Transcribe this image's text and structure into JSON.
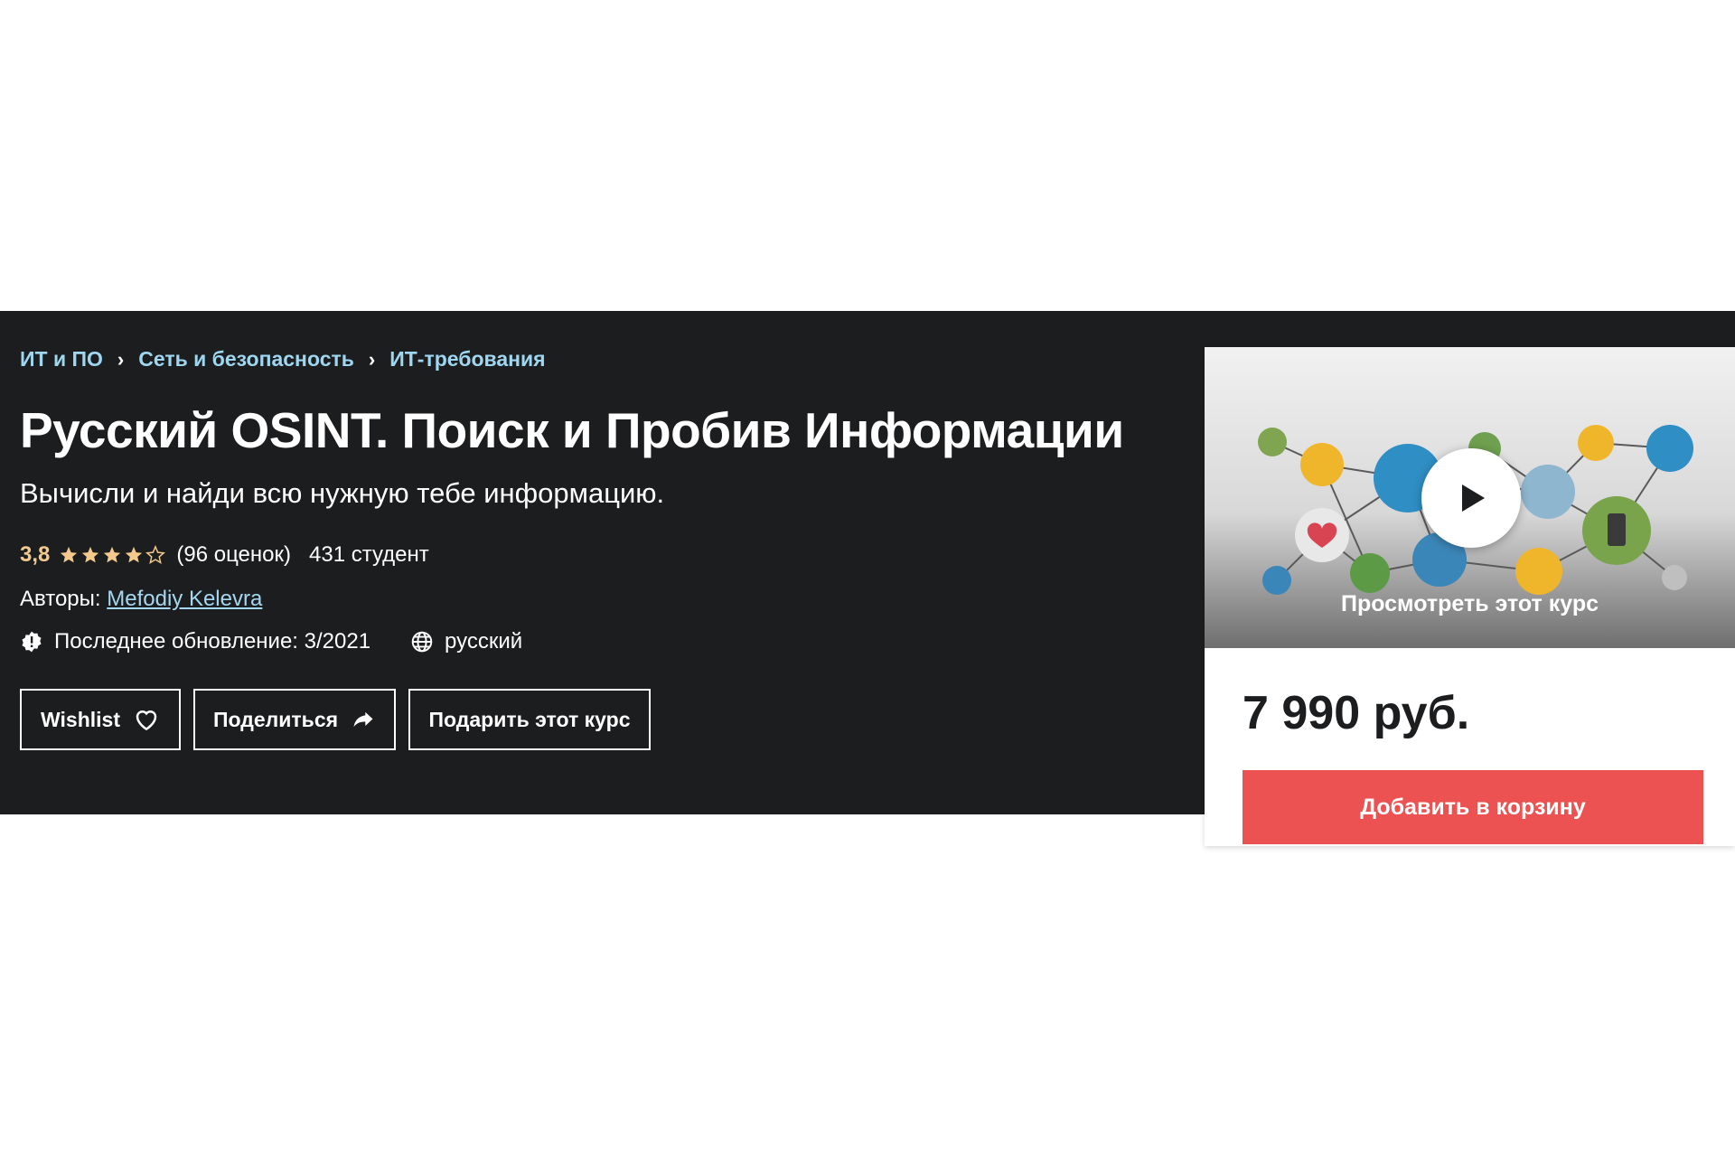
{
  "breadcrumb": [
    {
      "label": "ИТ и ПО"
    },
    {
      "label": "Сеть и безопасность"
    },
    {
      "label": "ИТ-требования"
    }
  ],
  "course": {
    "title": "Русский OSINT. Поиск и Пробив Информации",
    "subtitle": "Вычисли и найди всю нужную тебе информацию.",
    "rating": "3,8",
    "rating_stars": 3.8,
    "ratings_count": "(96 оценок)",
    "students": "431 студент",
    "authors_label": "Авторы:",
    "author": "Mefodiy Kelevra",
    "updated": "Последнее обновление: 3/2021",
    "language": "русский"
  },
  "actions": {
    "wishlist": "Wishlist",
    "share": "Поделиться",
    "gift": "Подарить этот курс"
  },
  "sidebar": {
    "preview_label": "Просмотреть этот курс",
    "price": "7 990 руб.",
    "add_to_cart": "Добавить в корзину"
  },
  "colors": {
    "hero_bg": "#1c1d1f",
    "rating": "#f3ca8c",
    "breadcrumb": "#9fd6f0",
    "cart_button": "#ec5252"
  },
  "icons": [
    "chevron-right-icon",
    "star-icon",
    "alert-icon",
    "globe-icon",
    "heart-icon",
    "share-arrow-icon",
    "play-icon"
  ]
}
